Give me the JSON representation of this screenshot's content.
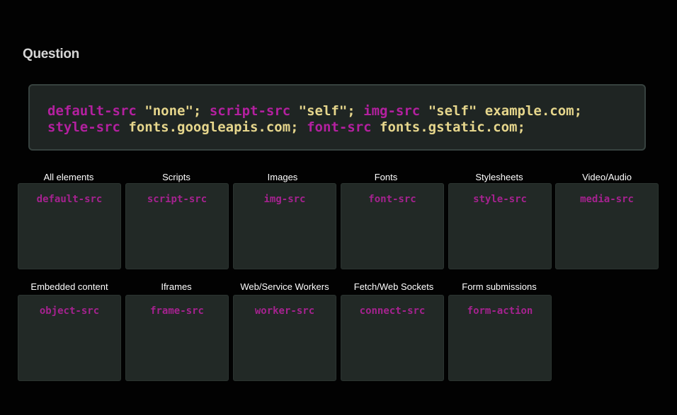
{
  "heading": "Question",
  "policy": {
    "line1": [
      {
        "kind": "dir",
        "text": "default-src"
      },
      {
        "kind": "val",
        "text": " \"none\""
      },
      {
        "kind": "pun",
        "text": "; "
      },
      {
        "kind": "dir",
        "text": "script-src"
      },
      {
        "kind": "val",
        "text": " \"self\""
      },
      {
        "kind": "pun",
        "text": "; "
      },
      {
        "kind": "dir",
        "text": "img-src"
      },
      {
        "kind": "val",
        "text": " \"self\" example.com"
      },
      {
        "kind": "pun",
        "text": ";"
      }
    ],
    "line2": [
      {
        "kind": "dir",
        "text": "style-src"
      },
      {
        "kind": "val",
        "text": " fonts.googleapis.com"
      },
      {
        "kind": "pun",
        "text": "; "
      },
      {
        "kind": "dir",
        "text": "font-src"
      },
      {
        "kind": "val",
        "text": " fonts.gstatic.com"
      },
      {
        "kind": "pun",
        "text": ";"
      }
    ]
  },
  "rows": [
    {
      "items": [
        {
          "category": "All elements",
          "directive": "default-src"
        },
        {
          "category": "Scripts",
          "directive": "script-src"
        },
        {
          "category": "Images",
          "directive": "img-src"
        },
        {
          "category": "Fonts",
          "directive": "font-src"
        },
        {
          "category": "Stylesheets",
          "directive": "style-src"
        },
        {
          "category": "Video/Audio",
          "directive": "media-src"
        }
      ]
    },
    {
      "items": [
        {
          "category": "Embedded content",
          "directive": "object-src"
        },
        {
          "category": "Iframes",
          "directive": "frame-src"
        },
        {
          "category": "Web/Service Workers",
          "directive": "worker-src"
        },
        {
          "category": "Fetch/Web Sockets",
          "directive": "connect-src"
        },
        {
          "category": "Form submissions",
          "directive": "form-action"
        }
      ]
    }
  ],
  "colors": {
    "background": "#020202",
    "code_background": "#1f2523",
    "directive": "#b3209f",
    "value": "#e6d68c",
    "card_background": "#222926"
  }
}
